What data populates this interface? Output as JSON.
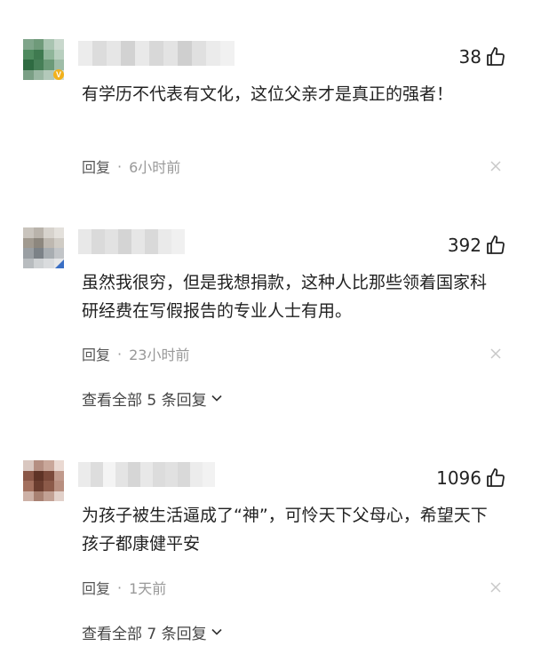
{
  "comments": [
    {
      "likes": "38",
      "text": "有学历不代表有文化，这位父亲才是真正的强者！",
      "reply_label": "回复",
      "separator": "·",
      "time": "6小时前",
      "badge": "V",
      "more_replies": null
    },
    {
      "likes": "392",
      "text": "虽然我很穷，但是我想捐款，这种人比那些领着国家科研经费在写假报告的专业人士有用。",
      "reply_label": "回复",
      "separator": "·",
      "time": "23小时前",
      "badge": null,
      "more_replies": "查看全部 5 条回复"
    },
    {
      "likes": "1096",
      "text": "为孩子被生活逼成了“神”，可怜天下父母心，希望天下孩子都康健平安",
      "reply_label": "回复",
      "separator": "·",
      "time": "1天前",
      "badge": null,
      "more_replies": "查看全部 7 条回复"
    }
  ],
  "icons": {
    "like": "thumbs-up-icon",
    "close": "close-icon",
    "chevron": "chevron-down-icon"
  },
  "colors": {
    "text": "#222222",
    "meta": "#999999",
    "badge_gold": "#f2b11c",
    "badge_blue": "#3a6fc4"
  }
}
